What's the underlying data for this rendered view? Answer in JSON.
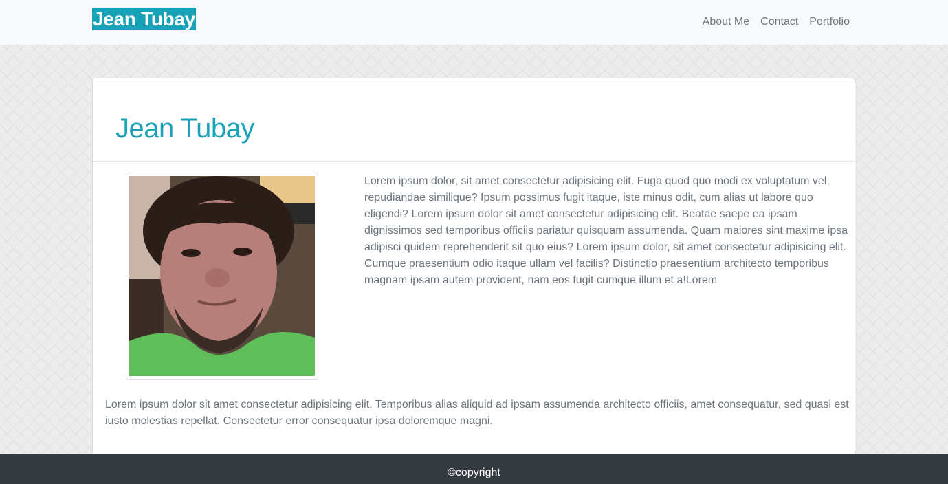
{
  "navbar": {
    "brand": "Jean Tubay",
    "links": [
      "About Me",
      "Contact",
      "Portfolio"
    ]
  },
  "card": {
    "title": "Jean Tubay",
    "photo_alt": "profile-photo",
    "bio": "Lorem ipsum dolor, sit amet consectetur adipisicing elit. Fuga quod quo modi ex voluptatum vel, repudiandae similique? Ipsum possimus fugit itaque, iste minus odit, cum alias ut labore quo eligendi? Lorem ipsum dolor sit amet consectetur adipisicing elit. Beatae saepe ea ipsam dignissimos sed temporibus officiis pariatur quisquam assumenda. Quam maiores sint maxime ipsa adipisci quidem reprehenderit sit quo eius? Lorem ipsum dolor, sit amet consectetur adipisicing elit. Cumque praesentium odio itaque ullam vel facilis? Distinctio praesentium architecto temporibus magnam ipsam autem provident, nam eos fugit cumque illum et a!Lorem",
    "bio_bottom": "Lorem ipsum dolor sit amet consectetur adipisicing elit. Temporibus alias aliquid ad ipsam assumenda architecto officiis, amet consequatur, sed quasi est iusto molestias repellat. Consectetur error consequatur ipsa doloremque magni."
  },
  "footer": {
    "text": "©copyright"
  },
  "colors": {
    "accent": "#17a2b8",
    "nav_text": "#6c757d",
    "footer_bg": "#343a40"
  }
}
